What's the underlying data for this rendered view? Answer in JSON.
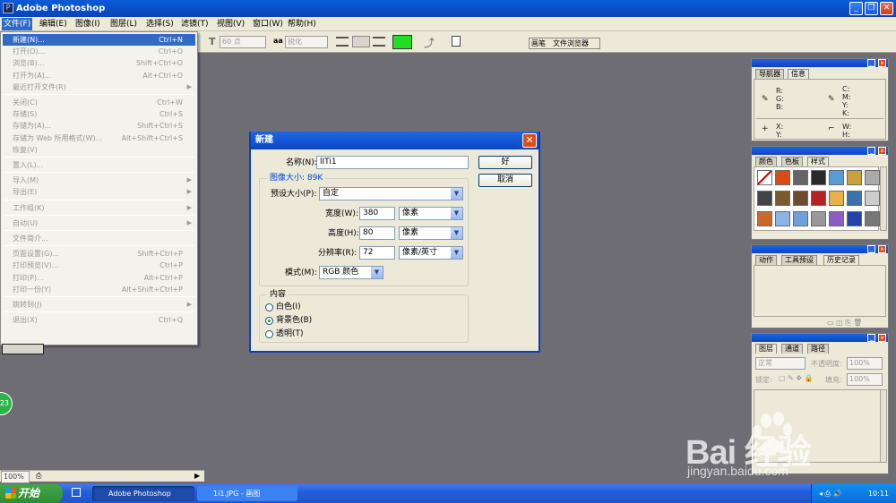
{
  "window": {
    "title": "Adobe Photoshop"
  },
  "menubar": [
    "文件(F)",
    "编辑(E)",
    "图像(I)",
    "图层(L)",
    "选择(S)",
    "滤镜(T)",
    "视图(V)",
    "窗口(W)",
    "帮助(H)"
  ],
  "options": {
    "font_size": "60 点",
    "aa_label": "aa",
    "aa_value": "锐化",
    "color_swatch": "#22dd22"
  },
  "palette_tabs": [
    "画笔",
    "文件浏览器"
  ],
  "file_menu": [
    {
      "label": "新建(N)...",
      "shortcut": "Ctrl+N",
      "selected": true
    },
    {
      "label": "打开(O)...",
      "shortcut": "Ctrl+O"
    },
    {
      "label": "浏览(B)...",
      "shortcut": "Shift+Ctrl+O"
    },
    {
      "label": "打开为(A)...",
      "shortcut": "Alt+Ctrl+O"
    },
    {
      "label": "最近打开文件(R)",
      "submenu": true
    },
    {
      "separator": true
    },
    {
      "label": "关闭(C)",
      "shortcut": "Ctrl+W"
    },
    {
      "label": "存储(S)",
      "shortcut": "Ctrl+S"
    },
    {
      "label": "存储为(A)...",
      "shortcut": "Shift+Ctrl+S"
    },
    {
      "label": "存储为 Web 所用格式(W)...",
      "shortcut": "Alt+Shift+Ctrl+S"
    },
    {
      "label": "恢复(V)"
    },
    {
      "separator": true
    },
    {
      "label": "置入(L)..."
    },
    {
      "separator": true
    },
    {
      "label": "导入(M)",
      "submenu": true
    },
    {
      "label": "导出(E)",
      "submenu": true
    },
    {
      "separator": true
    },
    {
      "label": "工作组(K)",
      "submenu": true
    },
    {
      "separator": true
    },
    {
      "label": "自动(U)",
      "submenu": true
    },
    {
      "separator": true
    },
    {
      "label": "文件简介..."
    },
    {
      "separator": true
    },
    {
      "label": "页面设置(G)...",
      "shortcut": "Shift+Ctrl+P"
    },
    {
      "label": "打印预览(V)...",
      "shortcut": "Ctrl+P"
    },
    {
      "label": "打印(P)...",
      "shortcut": "Alt+Ctrl+P"
    },
    {
      "label": "打印一份(Y)",
      "shortcut": "Alt+Shift+Ctrl+P"
    },
    {
      "separator": true
    },
    {
      "label": "跳转到(J)",
      "submenu": true
    },
    {
      "separator": true
    },
    {
      "label": "退出(X)",
      "shortcut": "Ctrl+Q"
    }
  ],
  "dialog": {
    "title": "新建",
    "name_label": "名称(N):",
    "name_value": "lITi1",
    "ok_label": "好",
    "cancel_label": "取消",
    "image_size_label": "图像大小: 89K",
    "preset_label": "预设大小(P):",
    "preset_value": "自定",
    "width_label": "宽度(W):",
    "width_value": "380",
    "width_unit": "像素",
    "height_label": "高度(H):",
    "height_value": "80",
    "height_unit": "像素",
    "resolution_label": "分辨率(R):",
    "resolution_value": "72",
    "resolution_unit": "像素/英寸",
    "mode_label": "模式(M):",
    "mode_value": "RGB 颜色",
    "contents_label": "内容",
    "contents_options": [
      {
        "label": "白色(I)",
        "checked": false
      },
      {
        "label": "背景色(B)",
        "checked": true
      },
      {
        "label": "透明(T)",
        "checked": false
      }
    ]
  },
  "panels": {
    "navigator": {
      "tabs": [
        "导航器",
        "信息"
      ],
      "rgb": "R:\nG:\nB:",
      "cmyk": "C:\nM:\nY:\nK:",
      "xy": "X:\nY:",
      "wh": "W:\nH:"
    },
    "color": {
      "tabs": [
        "颜色",
        "色板",
        "样式"
      ]
    },
    "history": {
      "tabs": [
        "动作",
        "工具预设",
        "历史记录"
      ]
    },
    "layers": {
      "tabs": [
        "图层",
        "通道",
        "路径"
      ],
      "blend_mode": "正常",
      "opacity_label": "不透明度:",
      "opacity_value": "100%",
      "lock_label": "锁定:",
      "fill_label": "填充:",
      "fill_value": "100%"
    }
  },
  "status": {
    "zoom": "100%"
  },
  "taskbar": {
    "start_label": "开始",
    "tasks": [
      "Adobe Photoshop",
      "1i1.JPG - 画图"
    ],
    "clock": "10:11"
  },
  "left_circle_text": "23",
  "watermark": {
    "text": "Bai 经验",
    "url": "jingyan.baidu.com"
  }
}
